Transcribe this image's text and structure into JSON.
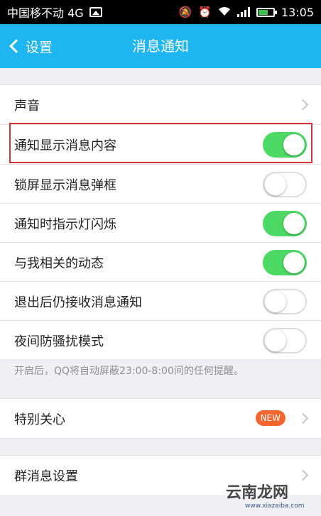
{
  "status_bar": {
    "carrier": "中国移不动 4G",
    "time": "13:05"
  },
  "nav": {
    "back_label": "设置",
    "title": "消息通知"
  },
  "settings": {
    "sound": "声音",
    "items": [
      {
        "label": "通知显示消息内容",
        "on": true
      },
      {
        "label": "锁屏显示消息弹框",
        "on": false
      },
      {
        "label": "通知时指示灯闪烁",
        "on": true
      },
      {
        "label": "与我相关的动态",
        "on": true
      },
      {
        "label": "退出后仍接收消息通知",
        "on": false
      },
      {
        "label": "夜间防骚扰模式",
        "on": false
      }
    ],
    "hint": "开启后，QQ将自动屏蔽23:00-8:00间的任何提醒。",
    "special_care": "特别关心",
    "new_badge": "NEW",
    "group_settings": "群消息设置"
  },
  "watermark": {
    "text": "云南龙网",
    "url": "www.xiazaiba.com"
  },
  "colors": {
    "nav_blue": "#1eb5f1",
    "toggle_green": "#4cd964",
    "badge_orange": "#f2652e",
    "highlight_red": "#d8333a"
  }
}
